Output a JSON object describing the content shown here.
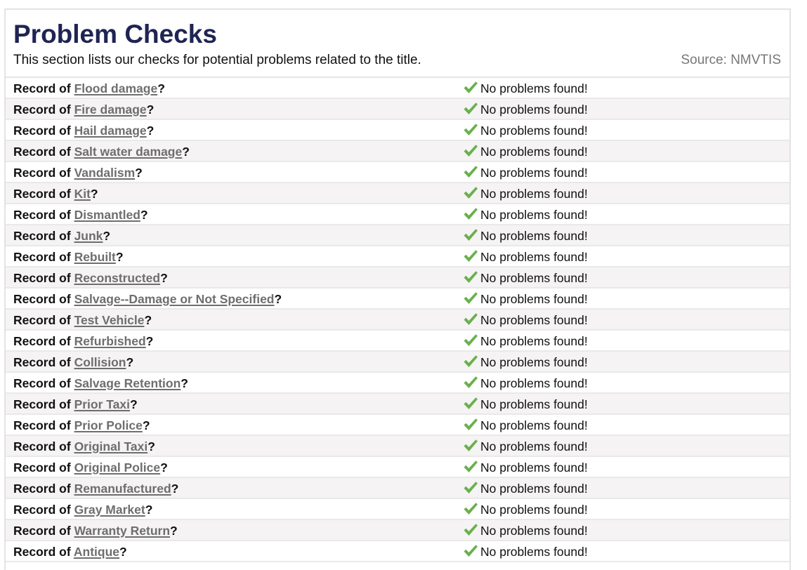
{
  "header": {
    "title": "Problem Checks",
    "subtitle": "This section lists our checks for potential problems related to the title.",
    "source": "Source: NMVTIS"
  },
  "record_prefix": "Record of",
  "question_mark": "?",
  "status_text": "No problems found!",
  "status_icon": "check-icon",
  "colors": {
    "title": "#1f2453",
    "link": "#6e6e6e",
    "check": "#6ab04c",
    "row_alt": "#f5f3f4"
  },
  "checks": [
    {
      "name": "Flood damage",
      "status": "No problems found!"
    },
    {
      "name": "Fire damage",
      "status": "No problems found!"
    },
    {
      "name": "Hail damage",
      "status": "No problems found!"
    },
    {
      "name": "Salt water damage",
      "status": "No problems found!"
    },
    {
      "name": "Vandalism",
      "status": "No problems found!"
    },
    {
      "name": "Kit",
      "status": "No problems found!"
    },
    {
      "name": "Dismantled",
      "status": "No problems found!"
    },
    {
      "name": "Junk",
      "status": "No problems found!"
    },
    {
      "name": "Rebuilt",
      "status": "No problems found!"
    },
    {
      "name": "Reconstructed",
      "status": "No problems found!"
    },
    {
      "name": "Salvage--Damage or Not Specified",
      "status": "No problems found!"
    },
    {
      "name": "Test Vehicle",
      "status": "No problems found!"
    },
    {
      "name": "Refurbished",
      "status": "No problems found!"
    },
    {
      "name": "Collision",
      "status": "No problems found!"
    },
    {
      "name": "Salvage Retention",
      "status": "No problems found!"
    },
    {
      "name": "Prior Taxi",
      "status": "No problems found!"
    },
    {
      "name": "Prior Police",
      "status": "No problems found!"
    },
    {
      "name": "Original Taxi",
      "status": "No problems found!"
    },
    {
      "name": "Original Police",
      "status": "No problems found!"
    },
    {
      "name": "Remanufactured",
      "status": "No problems found!"
    },
    {
      "name": "Gray Market",
      "status": "No problems found!"
    },
    {
      "name": "Warranty Return",
      "status": "No problems found!"
    },
    {
      "name": "Antique",
      "status": "No problems found!"
    }
  ]
}
